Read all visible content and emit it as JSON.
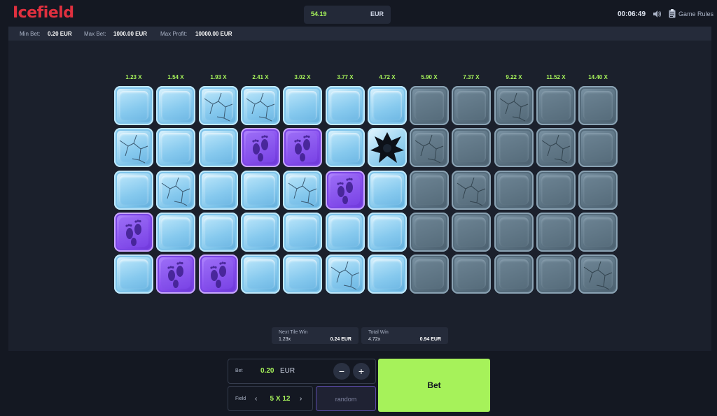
{
  "header": {
    "logo": "Icefield",
    "balance": "54.19",
    "currency": "EUR",
    "timer": "00:06:49",
    "rules_label": "Game Rules",
    "sound_icon": "speaker-icon",
    "rules_icon": "clipboard-icon"
  },
  "limits": {
    "min_bet_label": "Min Bet:",
    "min_bet_value": "0.20 EUR",
    "max_bet_label": "Max Bet:",
    "max_bet_value": "1000.00 EUR",
    "max_profit_label": "Max Profit:",
    "max_profit_value": "10000.00 EUR"
  },
  "board": {
    "multipliers": [
      "1.23 X",
      "1.54 X",
      "1.93 X",
      "2.41 X",
      "3.02 X",
      "3.77 X",
      "4.72 X",
      "5.90 X",
      "7.37 X",
      "9.22 X",
      "11.52 X",
      "14.40 X"
    ],
    "rows": [
      [
        "ice",
        "ice",
        "ice-cracked",
        "ice-cracked",
        "ice",
        "ice",
        "ice",
        "dim",
        "dim",
        "dim-cracked",
        "dim",
        "dim"
      ],
      [
        "ice-cracked",
        "ice",
        "ice",
        "footprint",
        "footprint",
        "ice",
        "broken",
        "dim-cracked",
        "dim",
        "dim",
        "dim-cracked",
        "dim"
      ],
      [
        "ice",
        "ice-cracked",
        "ice",
        "ice",
        "ice-cracked",
        "footprint",
        "ice",
        "dim",
        "dim-cracked",
        "dim",
        "dim",
        "dim"
      ],
      [
        "footprint",
        "ice",
        "ice",
        "ice",
        "ice",
        "ice",
        "ice",
        "dim",
        "dim",
        "dim",
        "dim",
        "dim"
      ],
      [
        "ice",
        "footprint",
        "footprint",
        "ice",
        "ice",
        "ice-cracked",
        "ice",
        "dim",
        "dim",
        "dim",
        "dim",
        "dim-cracked"
      ]
    ]
  },
  "wins": {
    "next_label": "Next Tile Win",
    "next_mult": "1.23x",
    "next_amount": "0.24 EUR",
    "total_label": "Total Win",
    "total_mult": "4.72x",
    "total_amount": "0.94 EUR"
  },
  "controls": {
    "bet_label": "Bet",
    "bet_value": "0.20",
    "bet_currency": "EUR",
    "minus": "−",
    "plus": "+",
    "field_label": "Field",
    "field_prev": "‹",
    "field_next": "›",
    "field_value": "5 X 12",
    "random_label": "random",
    "bet_button": "Bet"
  }
}
